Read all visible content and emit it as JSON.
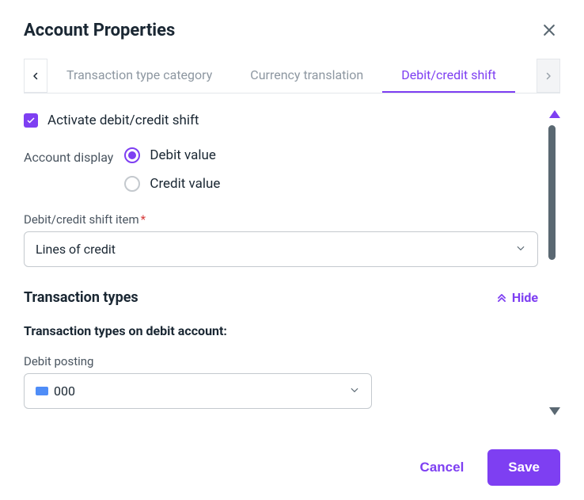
{
  "header": {
    "title": "Account Properties"
  },
  "tabs": {
    "items": [
      {
        "label": "Transaction type category"
      },
      {
        "label": "Currency translation"
      },
      {
        "label": "Debit/credit shift"
      }
    ]
  },
  "form": {
    "activate_label": "Activate debit/credit shift",
    "account_display_label": "Account display",
    "radio_debit": "Debit value",
    "radio_credit": "Credit value",
    "shift_item_label": "Debit/credit shift item",
    "shift_item_value": "Lines of credit",
    "section_title": "Transaction types",
    "hide_label": "Hide",
    "subsection_title": "Transaction types on debit account:",
    "debit_posting_label": "Debit posting",
    "debit_posting_value": "000"
  },
  "footer": {
    "cancel": "Cancel",
    "save": "Save"
  }
}
